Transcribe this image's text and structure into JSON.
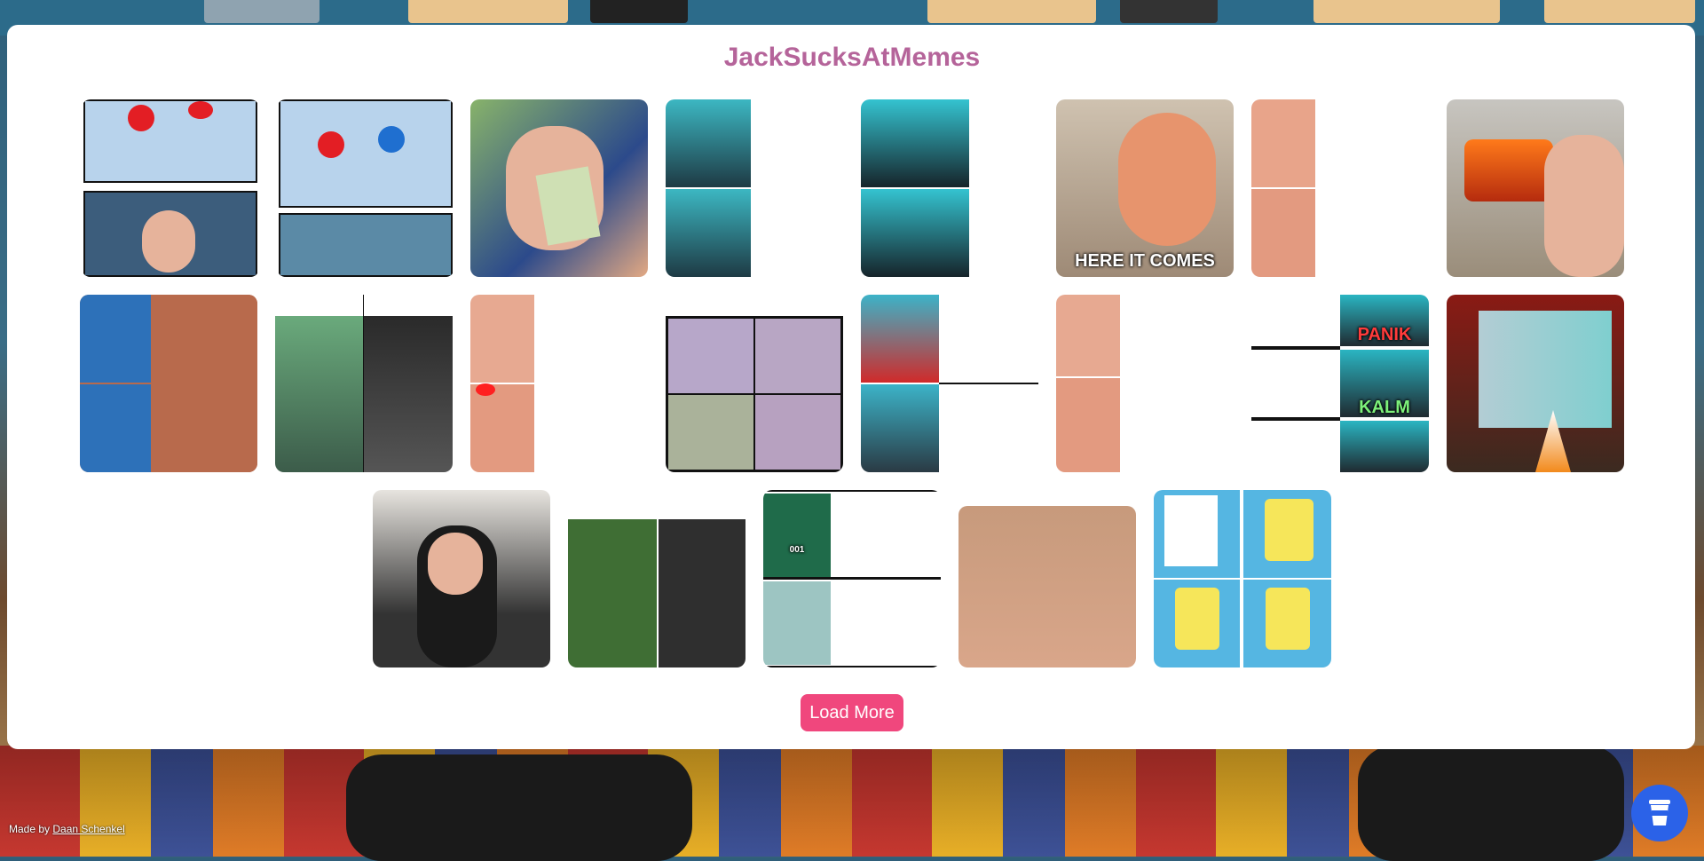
{
  "page": {
    "title": "JackSucksAtMemes",
    "load_more_label": "Load More",
    "footer_prefix": "Made by ",
    "footer_author": "Daan Schenkel"
  },
  "memes": [
    {
      "name": "meme-two-buttons",
      "caption": ""
    },
    {
      "name": "meme-two-buttons-alt",
      "caption": ""
    },
    {
      "name": "meme-money-tears",
      "caption": ""
    },
    {
      "name": "meme-thinking-pair",
      "caption": ""
    },
    {
      "name": "meme-mic-pair",
      "caption": ""
    },
    {
      "name": "meme-here-it-comes",
      "caption": "HERE IT COMES"
    },
    {
      "name": "meme-glasses-smile",
      "caption": ""
    },
    {
      "name": "meme-disaster-fire",
      "caption": ""
    },
    {
      "name": "meme-hoodie-pair",
      "caption": ""
    },
    {
      "name": "meme-suit-comparison",
      "caption": ""
    },
    {
      "name": "meme-laser-eyes",
      "caption": ""
    },
    {
      "name": "meme-four-panel-thinking",
      "caption": ""
    },
    {
      "name": "meme-mustache",
      "caption": ""
    },
    {
      "name": "meme-glasses-pair",
      "caption": ""
    },
    {
      "name": "meme-panik-kalm",
      "labels": [
        "PANIK",
        "KALM"
      ]
    },
    {
      "name": "meme-movie-screen",
      "caption": ""
    },
    {
      "name": "meme-pointing-headset",
      "caption": ""
    },
    {
      "name": "meme-plant-point",
      "caption": ""
    },
    {
      "name": "meme-squid-game",
      "caption": "001"
    },
    {
      "name": "meme-closeup-face",
      "caption": ""
    },
    {
      "name": "meme-spongebob",
      "caption": ""
    }
  ],
  "colors": {
    "title": "#b5649a",
    "load_more": "#f0477d",
    "coffee_button": "#2b62e8"
  },
  "icons": {
    "coffee": "coffee-cup-icon"
  }
}
